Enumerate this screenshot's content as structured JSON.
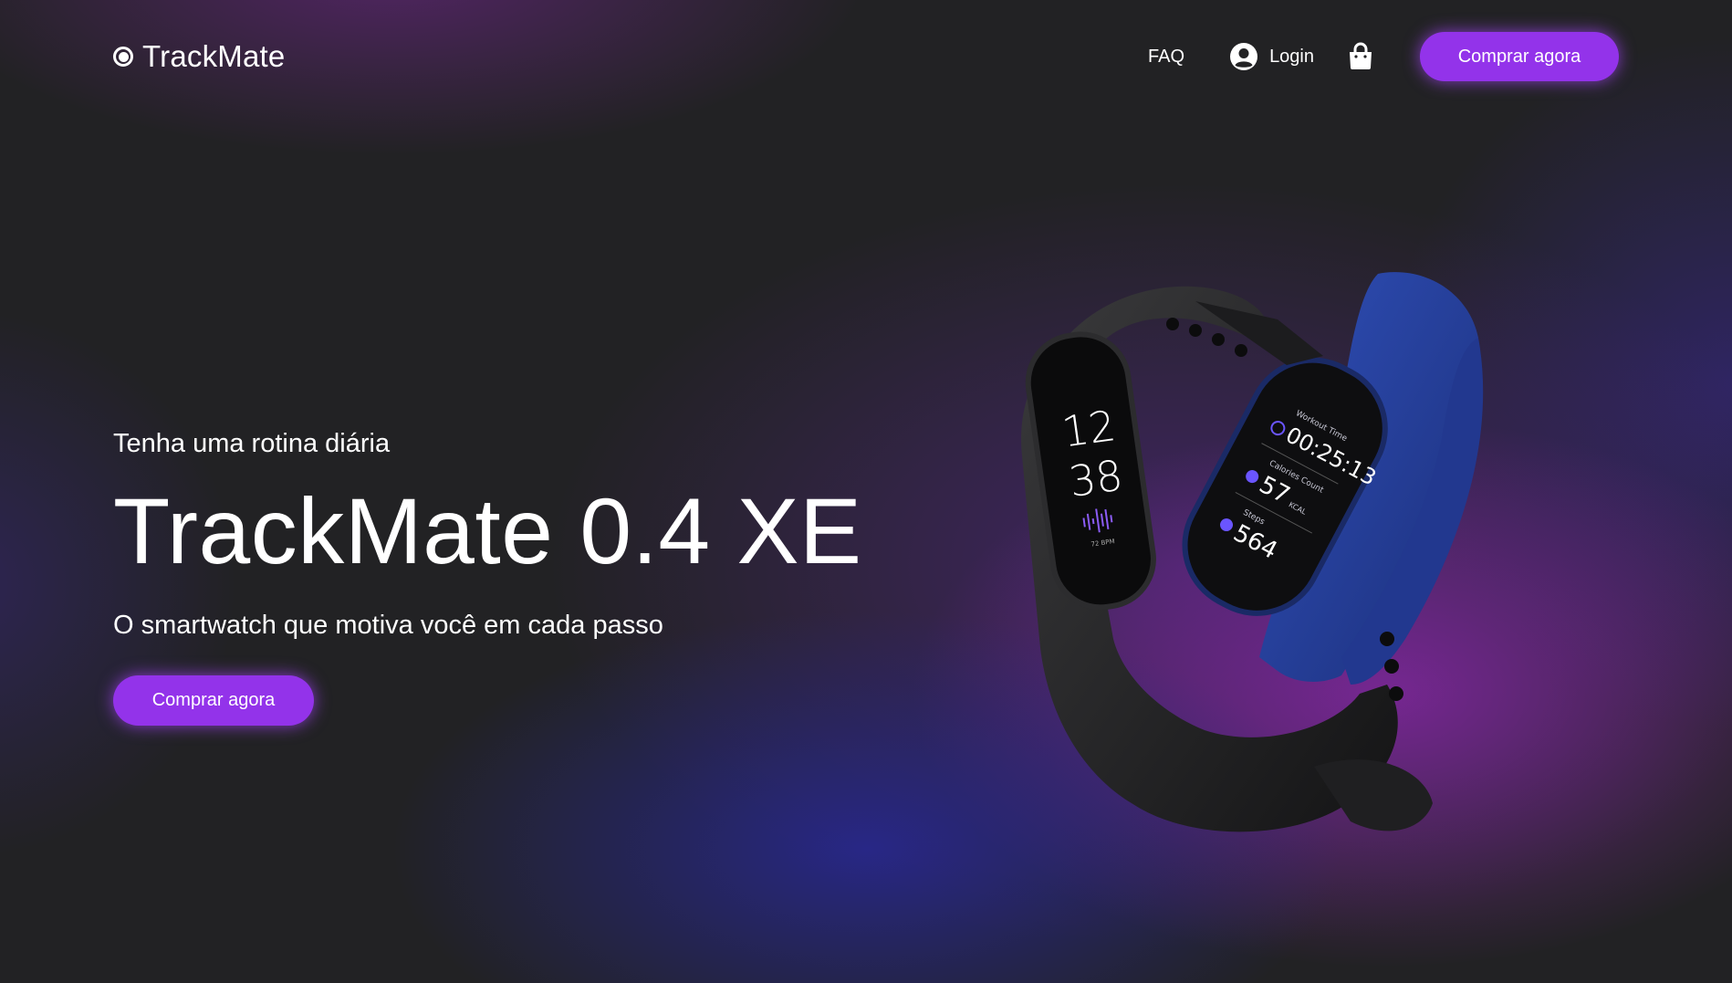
{
  "header": {
    "brand": "TrackMate",
    "nav": {
      "faq": "FAQ",
      "login": "Login",
      "cta": "Comprar agora"
    }
  },
  "hero": {
    "kicker": "Tenha uma rotina diária",
    "title": "TrackMate 0.4 XE",
    "subtitle": "O smartwatch que motiva você em cada passo",
    "cta": "Comprar agora"
  },
  "product": {
    "black_band": {
      "hour": "12",
      "minute": "38",
      "bpm": "72 BPM"
    },
    "blue_band": {
      "workout_label": "Workout Time",
      "workout_value": "00:25:13",
      "calories_label": "Calories Count",
      "calories_value": "57",
      "calories_unit": "KCAL",
      "steps_label": "Steps",
      "steps_value": "564"
    }
  },
  "icons": {
    "brand": "record-circle-icon",
    "login": "user-circle-icon",
    "cart": "shopping-bag-icon"
  },
  "colors": {
    "accent": "#9333ea",
    "background": "#222224",
    "blue_band": "#24409a",
    "black_band": "#222222"
  }
}
